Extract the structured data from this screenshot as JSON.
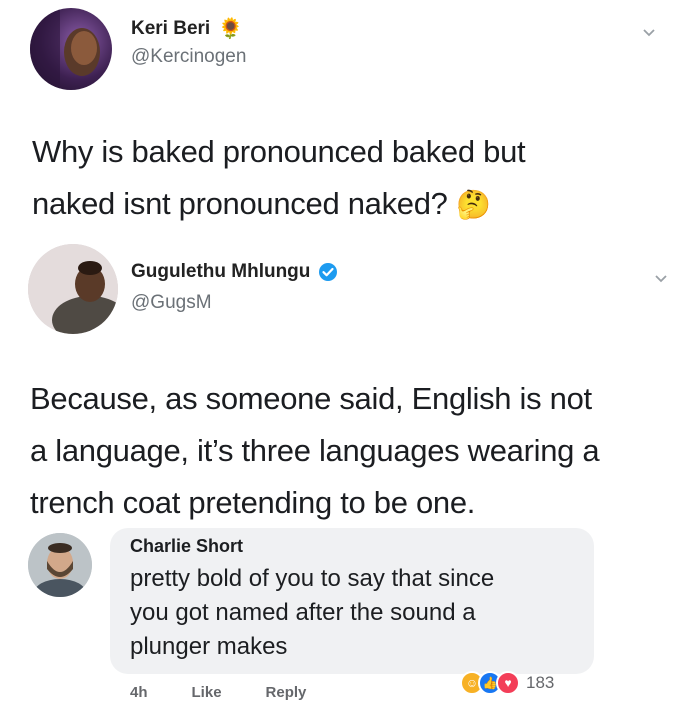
{
  "tweet1": {
    "name": "Keri Beri",
    "name_emoji": "🌻",
    "handle": "@Kercinogen",
    "text_line1": "Why is baked pronounced baked but",
    "text_line2": "naked isnt pronounced naked?",
    "text_emoji": "🤔"
  },
  "tweet2": {
    "name": "Gugulethu Mhlungu",
    "verified_icon": "verified-badge-icon",
    "handle": "@GugsM",
    "text_line1": "Because, as someone said, English is not",
    "text_line2": "a language, it’s three languages wearing a",
    "text_line3": "trench coat pretending to be one."
  },
  "comment": {
    "name": "Charlie Short",
    "text_line1": "pretty bold of you to say that since",
    "text_line2": "you got named after the sound a",
    "text_line3": "plunger makes",
    "reaction_count": "183",
    "actions": [
      "4h",
      "Like",
      "Reply"
    ]
  },
  "colors": {
    "verified": "#1d9bf0",
    "like_blue": "#1877f2",
    "love_red": "#f33e58",
    "haha_yellow": "#f7b125"
  }
}
